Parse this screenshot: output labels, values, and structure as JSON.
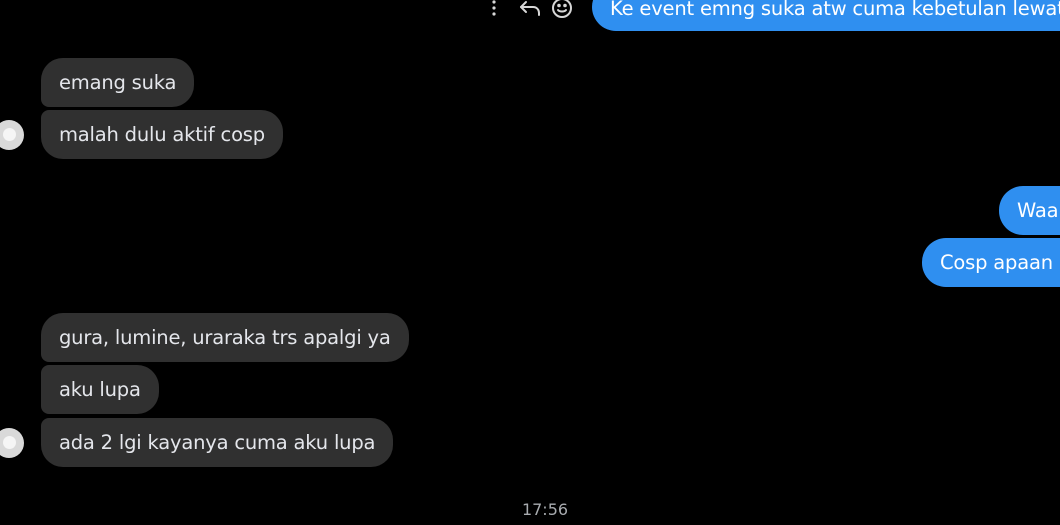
{
  "top_message": {
    "text": "Ke event emng suka atw cuma kebetulan lewat?"
  },
  "message_actions": {
    "more": "more-options-icon",
    "reply": "reply-icon",
    "react": "emoji-icon"
  },
  "messages_received_group_1": [
    "emang suka",
    "malah dulu aktif cosp"
  ],
  "messages_sent_group": [
    "Waa",
    "Cosp apaan"
  ],
  "messages_received_group_2": [
    "gura, lumine, uraraka trs apalgi ya",
    "aku lupa",
    "ada 2 lgi kayanya cuma aku lupa"
  ],
  "timestamp": "17:56",
  "colors": {
    "background": "#000000",
    "incoming_bubble": "#303030",
    "outgoing_bubble": "#2f8ff0",
    "timestamp": "#a8abaf"
  }
}
